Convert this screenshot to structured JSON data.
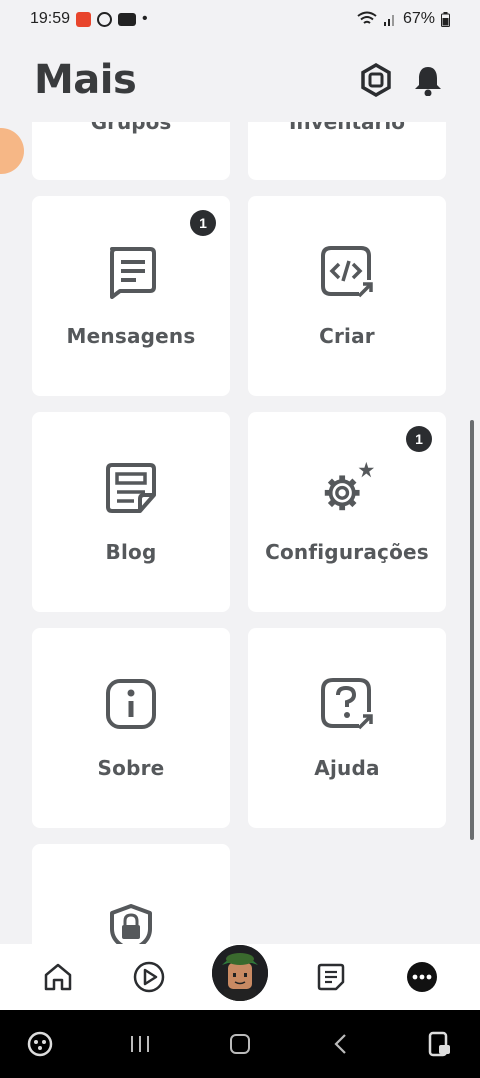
{
  "status_bar": {
    "time": "19:59",
    "battery": "67%",
    "dot": "•"
  },
  "header": {
    "title": "Mais"
  },
  "tiles": {
    "groups_label": "Grupos",
    "inventory_label": "Inventário",
    "messages": {
      "label": "Mensagens",
      "badge": "1",
      "icon": "messages-icon"
    },
    "create": {
      "label": "Criar",
      "icon": "code-icon"
    },
    "blog": {
      "label": "Blog",
      "icon": "blog-icon"
    },
    "settings": {
      "label": "Configurações",
      "badge": "1",
      "icon": "gear-icon"
    },
    "about": {
      "label": "Sobre",
      "icon": "info-icon"
    },
    "help": {
      "label": "Ajuda",
      "icon": "help-icon"
    },
    "parental": {
      "icon": "lock-shield-icon"
    }
  },
  "bottom_nav": [
    "home-icon",
    "play-icon",
    "avatar",
    "feed-icon",
    "more-icon"
  ],
  "colors": {
    "background": "#f2f2f4",
    "tile": "#ffffff",
    "icon": "#55585b",
    "badge": "#2b2d30"
  }
}
